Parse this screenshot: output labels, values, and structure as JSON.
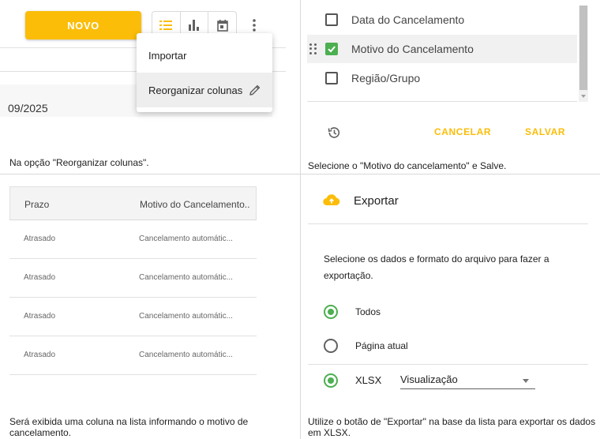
{
  "panel1": {
    "novo_label": "NOVO",
    "view_icons": [
      "list-view-icon",
      "chart-view-icon",
      "calendar-view-icon"
    ],
    "more_icon": "more-vertical-icon",
    "date_partial": "09/2025",
    "menu": {
      "items": [
        "Importar",
        "Reorganizar colunas"
      ],
      "edit_icon": "pencil-icon"
    },
    "caption": "Na opção \"Reorganizar colunas\"."
  },
  "panel2": {
    "columns": [
      {
        "label": "Data do Cancelamento",
        "checked": false
      },
      {
        "label": "Motivo do Cancelamento",
        "checked": true
      },
      {
        "label": "Região/Grupo",
        "checked": false
      }
    ],
    "drag_icon": "drag-handle-icon",
    "history_icon": "history-icon",
    "cancel_label": "CANCELAR",
    "save_label": "SALVAR",
    "caption": "Selecione o \"Motivo do cancelamento\" e Salve."
  },
  "panel3": {
    "headers": [
      "Prazo",
      "Motivo do Cancelamento.."
    ],
    "rows": [
      [
        "Atrasado",
        "Cancelamento automátic..."
      ],
      [
        "Atrasado",
        "Cancelamento automátic..."
      ],
      [
        "Atrasado",
        "Cancelamento automátic..."
      ],
      [
        "Atrasado",
        "Cancelamento automátic..."
      ]
    ],
    "caption": "Será exibida uma coluna na lista informando o motivo de cancelamento."
  },
  "panel4": {
    "title": "Exportar",
    "cloud_icon": "cloud-upload-icon",
    "description": "Selecione os dados e formato do arquivo para fazer a exportação.",
    "options": [
      {
        "label": "Todos",
        "selected": true
      },
      {
        "label": "Página atual",
        "selected": false
      }
    ],
    "format": {
      "label": "XLSX",
      "selected": true
    },
    "select_value": "Visualização",
    "caption": "Utilize o botão de \"Exportar\" na base da lista para exportar os dados em XLSX."
  },
  "colors": {
    "accent": "#fbbd08",
    "checked": "#4caf50",
    "divider": "#e0e0e0"
  }
}
